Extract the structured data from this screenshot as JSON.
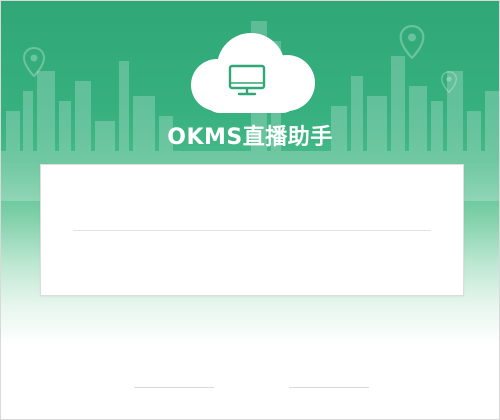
{
  "app": {
    "title": "OKMS直播助手"
  },
  "login": {
    "account_value": "",
    "password_value": ""
  },
  "colors": {
    "brand_green": "#2fa777",
    "card_background": "#ffffff",
    "divider": "#e3e3e3"
  },
  "icons": {
    "logo": "cloud-icon",
    "device": "monitor-icon",
    "background_markers": "location-pin-icon"
  }
}
